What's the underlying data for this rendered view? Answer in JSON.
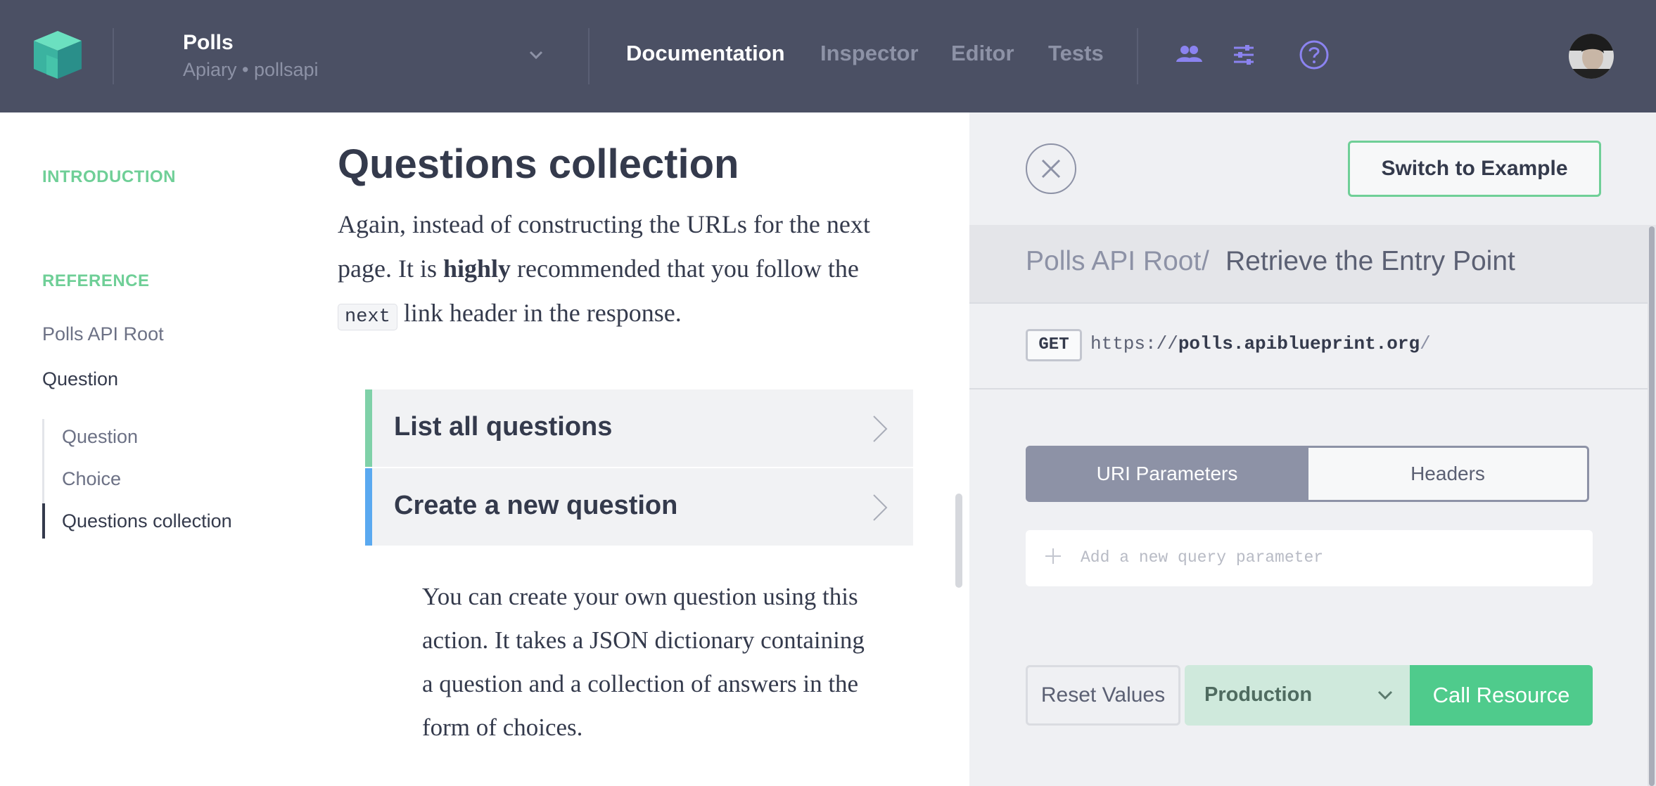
{
  "topbar": {
    "project_name": "Polls",
    "project_sub": "Apiary • pollsapi",
    "tabs": [
      {
        "label": "Documentation",
        "active": true
      },
      {
        "label": "Inspector",
        "active": false
      },
      {
        "label": "Editor",
        "active": false
      },
      {
        "label": "Tests",
        "active": false
      }
    ],
    "icons": [
      "team-icon",
      "settings-sliders-icon",
      "help-icon"
    ]
  },
  "sidebar": {
    "intro_heading": "INTRODUCTION",
    "reference_heading": "REFERENCE",
    "items": [
      {
        "label": "Polls API Root"
      },
      {
        "label": "Question"
      }
    ],
    "sub_items": [
      {
        "label": "Question"
      },
      {
        "label": "Choice"
      },
      {
        "label": "Questions collection",
        "current": true
      }
    ]
  },
  "main": {
    "title": "Questions collection",
    "para_part1": "Again, instead of constructing the URLs for the next page. It is ",
    "para_bold": "highly",
    "para_part2": " recommended that you follow the ",
    "para_code": "next",
    "para_part3": " link header in the response.",
    "actions": [
      {
        "label": "List all questions",
        "color": "#7fd1a8"
      },
      {
        "label": "Create a new question",
        "color": "#5aa9f0"
      }
    ],
    "description": "You can create your own question using this action. It takes a JSON dictionary containing a question and a collection of answers in the form of choices."
  },
  "console": {
    "switch_label": "Switch to Example",
    "breadcrumb_parent": "Polls API Root",
    "breadcrumb_sep": "/",
    "breadcrumb_current": "Retrieve the Entry Point",
    "method": "GET",
    "url_scheme": "https://",
    "url_host": "polls.apiblueprint.org",
    "url_path": "/",
    "segment_active": "URI Parameters",
    "segment_inactive": "Headers",
    "param_placeholder": "Add a new query parameter",
    "reset_label": "Reset Values",
    "environment": "Production",
    "call_label": "Call Resource"
  },
  "colors": {
    "topbar": "#4b5064",
    "accent_green": "#4fcb8c",
    "sidebar_heading": "#6fcf97"
  }
}
